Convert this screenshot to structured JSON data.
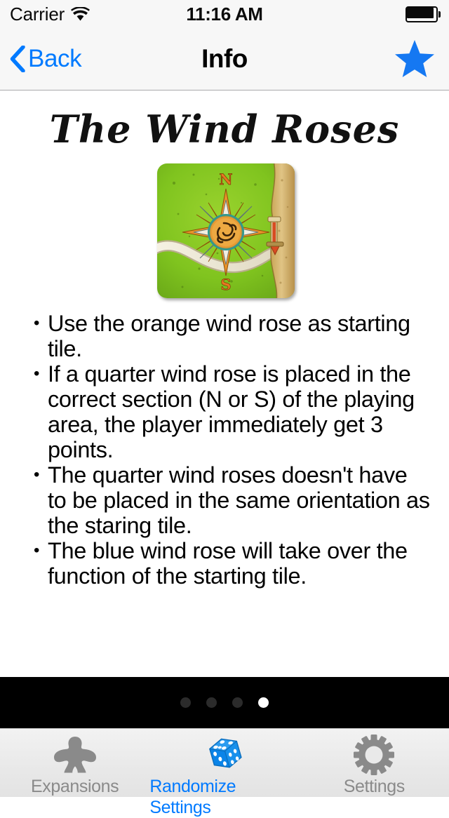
{
  "status_bar": {
    "carrier": "Carrier",
    "wifi_icon": "wifi-icon",
    "time": "11:16 AM",
    "battery_icon": "battery-full-icon"
  },
  "nav_bar": {
    "back_icon": "chevron-left-icon",
    "back_label": "Back",
    "title": "Info",
    "favorite_icon": "star-icon"
  },
  "content": {
    "page_title": "The Wind Roses",
    "tile_image": {
      "name": "wind-rose-tile-image",
      "alt": "Carcassonne wind rose tile: green field with orange compass rose, N at top, S at bottom",
      "field_color": "#7cbf22",
      "compass_orange": "#e8922a",
      "compass_white": "#f4f1e2",
      "road_color": "#efeadb",
      "edge_road_color": "#cdae62",
      "label_north": "N",
      "label_south": "S"
    },
    "rules": [
      "Use the orange wind rose as starting tile.",
      "If a quarter wind rose is placed in the correct section (N or S) of the playing area, the player immediately get 3 points.",
      "The quarter wind roses doesn't have to be placed in the same orientation as the staring tile.",
      "The blue wind rose will take over the function of the starting tile."
    ],
    "bullet_char": "•",
    "pentagon": {
      "name": "pentagon-shape",
      "color": "#8c8c8c"
    }
  },
  "page_control": {
    "total": 4,
    "current": 4,
    "dot_inactive_color": "#2b2b2b",
    "dot_active_color": "#ffffff",
    "background": "#000000"
  },
  "tab_bar": {
    "active_color": "#007aff",
    "inactive_color": "#8a8a8a",
    "items": [
      {
        "label": "Expansions",
        "icon": "meeple-icon",
        "active": false
      },
      {
        "label": "Randomize Settings",
        "icon": "dice-icon",
        "active": true
      },
      {
        "label": "Settings",
        "icon": "gear-icon",
        "active": false
      }
    ]
  }
}
